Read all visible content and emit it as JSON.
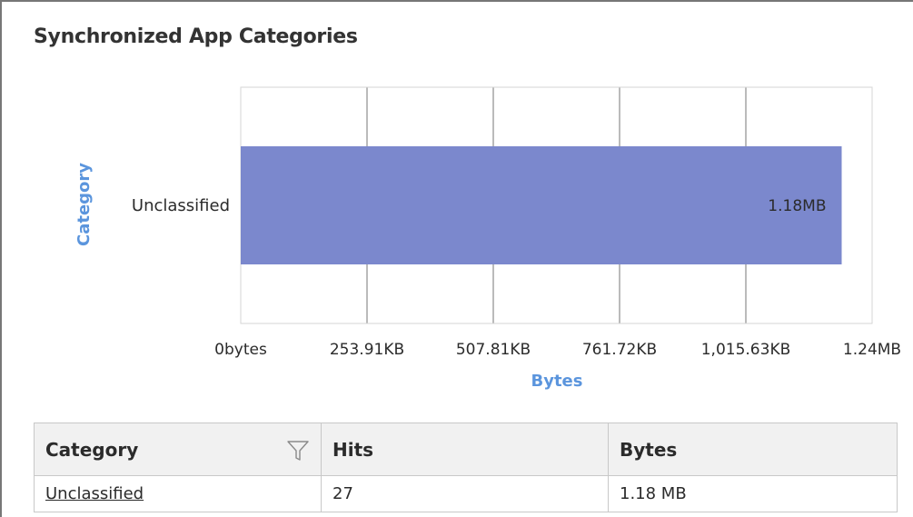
{
  "panel": {
    "title": "Synchronized App Categories"
  },
  "chart_data": {
    "type": "bar",
    "orientation": "horizontal",
    "categories": [
      "Unclassified"
    ],
    "values": [
      1.18
    ],
    "value_unit": "MB",
    "data_labels": [
      "1.18MB"
    ],
    "x_ticks": [
      0,
      253.91,
      507.81,
      761.72,
      1015.63,
      1269.53
    ],
    "x_tick_labels": [
      "0bytes",
      "253.91KB",
      "507.81KB",
      "761.72KB",
      "1,015.63KB",
      "1.24MB"
    ],
    "xlim": [
      0,
      1269.53
    ],
    "x_unit": "KB",
    "xlabel": "Bytes",
    "ylabel": "Category",
    "bar_color": "#7b88cd",
    "axis_title_color": "#5b95dd",
    "grid": true
  },
  "table": {
    "headers": [
      "Category",
      "Hits",
      "Bytes"
    ],
    "rows": [
      {
        "category": "Unclassified",
        "hits": "27",
        "bytes": "1.18 MB"
      }
    ]
  },
  "icons": {
    "filter": "filter-icon"
  }
}
